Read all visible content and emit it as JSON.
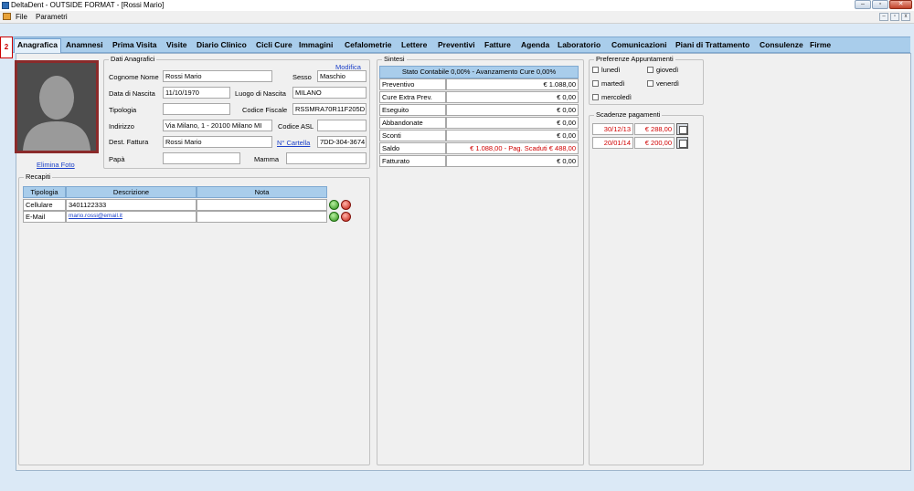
{
  "window": {
    "title": "DeltaDent - OUTSIDE FORMAT - [Rossi Mario]",
    "badge": "2"
  },
  "menu": [
    "File",
    "Parametri"
  ],
  "tabs": [
    "Anagrafica",
    "Anamnesi",
    "Prima Visita",
    "Visite",
    "Diario Clinico",
    "Cicli Cure",
    "Immagini",
    "Cefalometrie",
    "Lettere",
    "Preventivi",
    "Fatture",
    "Agenda",
    "Laboratorio",
    "Comunicazioni",
    "Piani di Trattamento",
    "Consulenze",
    "Firme"
  ],
  "photo": {
    "delete_label": "Elimina Foto"
  },
  "anagrafica": {
    "title": "Dati Anagrafici",
    "modify": "Modifica",
    "cognome_nome_label": "Cognome Nome",
    "cognome_nome": "Rossi Mario",
    "sesso_label": "Sesso",
    "sesso": "Maschio",
    "data_nascita_label": "Data di Nascita",
    "data_nascita": "11/10/1970",
    "luogo_nascita_label": "Luogo di Nascita",
    "luogo_nascita": "MILANO",
    "tipologia_label": "Tipologia",
    "tipologia": "",
    "codice_fiscale_label": "Codice Fiscale",
    "codice_fiscale": "RSSMRA70R11F205D",
    "indirizzo_label": "Indirizzo",
    "indirizzo": "Via Milano, 1 - 20100 Milano MI",
    "codice_asl_label": "Codice ASL",
    "codice_asl": "",
    "dest_fattura_label": "Dest. Fattura",
    "dest_fattura": "Rossi Mario",
    "cartella_label": "N° Cartella",
    "cartella": "7DD-304-3674",
    "papa_label": "Papà",
    "papa": "",
    "mamma_label": "Mamma",
    "mamma": ""
  },
  "recapiti": {
    "title": "Recapiti",
    "headers": [
      "Tipologia",
      "Descrizione",
      "Nota"
    ],
    "rows": [
      {
        "tipologia": "Cellulare",
        "descrizione": "3401122333",
        "nota": ""
      },
      {
        "tipologia": "E-Mail",
        "descrizione": "mario.rossi@email.it",
        "nota": ""
      }
    ]
  },
  "sintesi": {
    "title": "Sintesi",
    "header": "Stato Contabile 0,00% - Avanzamento Cure 0,00%",
    "rows": [
      {
        "label": "Preventivo",
        "value": "€ 1.088,00"
      },
      {
        "label": "Cure Extra Prev.",
        "value": "€ 0,00"
      },
      {
        "label": "Eseguito",
        "value": "€ 0,00"
      },
      {
        "label": "Abbandonate",
        "value": "€ 0,00"
      },
      {
        "label": "Sconti",
        "value": "€ 0,00"
      },
      {
        "label": "Saldo",
        "value": "€ 1.088,00 - Pag. Scaduti € 488,00"
      },
      {
        "label": "Fatturato",
        "value": "€ 0,00"
      }
    ]
  },
  "preferenze": {
    "title": "Preferenze Appuntamenti",
    "days": [
      "lunedì",
      "giovedì",
      "martedì",
      "venerdì",
      "mercoledì"
    ]
  },
  "scadenze": {
    "title": "Scadenze pagamenti",
    "rows": [
      {
        "date": "30/12/13",
        "amount": "€ 288,00"
      },
      {
        "date": "20/01/14",
        "amount": "€ 200,00"
      }
    ]
  },
  "colors": {
    "tab_bar": "#a9cdeb",
    "alert_red": "#d00000",
    "link": "#1a3fc8"
  }
}
